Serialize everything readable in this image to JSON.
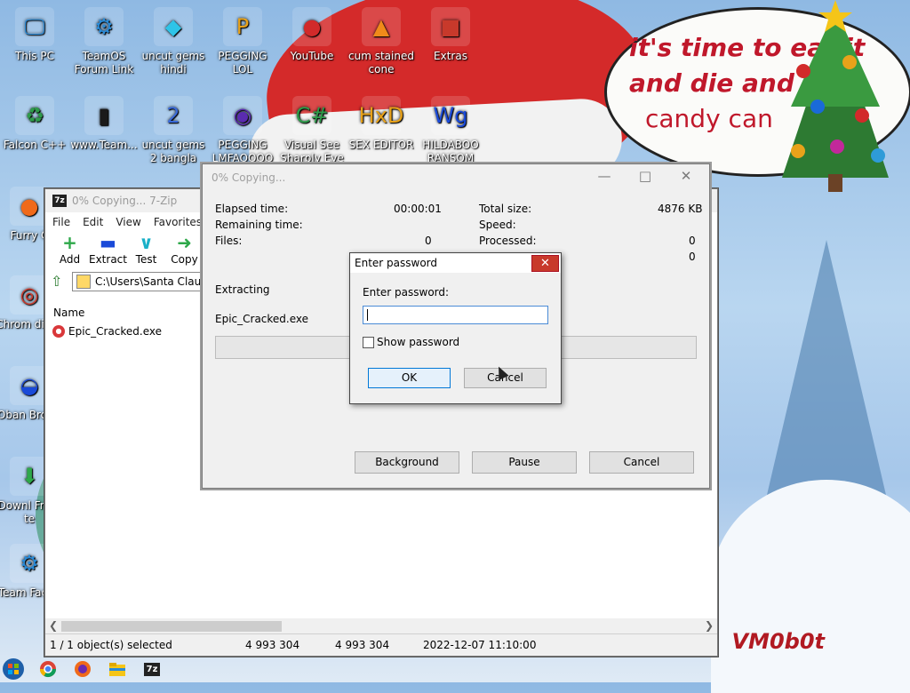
{
  "wallpaper": {
    "bubble_lines": [
      "it's time to eat it",
      "and die and",
      "candy can"
    ],
    "signature": "VM0b0t"
  },
  "desktop_icons": [
    {
      "label": "This PC",
      "icon": "computer-icon",
      "color": "#2a8bd8"
    },
    {
      "label": "TeamOS Forum Link",
      "icon": "gear-icon",
      "color": "#2a8bd8"
    },
    {
      "label": "uncut gems hindi",
      "icon": "gem-icon",
      "color": "#2ec4e8"
    },
    {
      "label": "PEGGING LOL",
      "icon": "p-logo-icon",
      "color": "#e8a21a"
    },
    {
      "label": "YouTube",
      "icon": "angry-bird-icon",
      "color": "#d22a2a"
    },
    {
      "label": "cum stained cone",
      "icon": "traffic-cone-icon",
      "color": "#f08a1a"
    },
    {
      "label": "Extras",
      "icon": "gift-icon",
      "color": "#c8392b"
    },
    {
      "label": "Falcon C++",
      "icon": "recycle-icon",
      "color": "#2e9b4a"
    },
    {
      "label": "www.Team...",
      "icon": "book-icon",
      "color": "#1a1a1a"
    },
    {
      "label": "uncut gems 2 bangla",
      "icon": "number-two-icon",
      "color": "#3a6ad8"
    },
    {
      "label": "PEGGING LMFAOOOO",
      "icon": "orb-icon",
      "color": "#5a2bb0"
    },
    {
      "label": "Visual See Sharply Eye",
      "icon": "csharp-icon",
      "color": "#2e9b4a"
    },
    {
      "label": "SEX EDITOR",
      "icon": "hex-editor-icon",
      "color": "#e8a21a"
    },
    {
      "label": "HILDABOO RANSOM",
      "icon": "wg-icon",
      "color": "#1a4ad8"
    },
    {
      "label": "Furry C",
      "icon": "firefox-icon",
      "color": "#f06a1a"
    },
    {
      "label": "Chrom disea",
      "icon": "chrome-icon",
      "color": "#d2382a"
    },
    {
      "label": "Oban Brows",
      "icon": "obama-logo-icon",
      "color": "#1a4ad8"
    },
    {
      "label": "Downl From te",
      "icon": "download-icon",
      "color": "#2ea84a"
    },
    {
      "label": "Team Faceb",
      "icon": "gear-icon",
      "color": "#2a8bd8"
    }
  ],
  "file_manager": {
    "title": "0% Copying... 7-Zip",
    "menu": [
      "File",
      "Edit",
      "View",
      "Favorites"
    ],
    "toolbar": [
      {
        "label": "Add",
        "icon": "plus-icon",
        "color": "#2ea84a"
      },
      {
        "label": "Extract",
        "icon": "minus-icon",
        "color": "#1a4ad8"
      },
      {
        "label": "Test",
        "icon": "check-icon",
        "color": "#1ab0c8"
      },
      {
        "label": "Copy",
        "icon": "arrow-right-icon",
        "color": "#2ea84a"
      }
    ],
    "path": "C:\\Users\\Santa Claus\\",
    "column_name": "Name",
    "files": [
      {
        "name": "Epic_Cracked.exe"
      }
    ],
    "status": {
      "selection": "1 / 1 object(s) selected",
      "size": "4 993 304",
      "packed": "4 993 304",
      "modified": "2022-12-07 11:10:00"
    }
  },
  "copy_window": {
    "title": "0% Copying...",
    "elapsed_label": "Elapsed time:",
    "elapsed_value": "00:00:01",
    "remaining_label": "Remaining time:",
    "files_label": "Files:",
    "files_value": "0",
    "total_label": "Total size:",
    "total_value": "4876 KB",
    "speed_label": "Speed:",
    "processed_label": "Processed:",
    "processed_value": "0",
    "extra_value": "0",
    "extracting_label": "Extracting",
    "current_file": "Epic_Cracked.exe",
    "progress": 0,
    "buttons": {
      "background": "Background",
      "pause": "Pause",
      "cancel": "Cancel"
    }
  },
  "password_dialog": {
    "title": "Enter password",
    "prompt": "Enter password:",
    "value": "",
    "show_password_label": "Show password",
    "show_password_checked": false,
    "ok": "OK",
    "cancel": "Cancel"
  },
  "taskbar": [
    {
      "name": "start-icon"
    },
    {
      "name": "chrome-icon"
    },
    {
      "name": "firefox-icon"
    },
    {
      "name": "file-explorer-icon"
    },
    {
      "name": "seven-zip-icon",
      "text": "7z"
    }
  ]
}
